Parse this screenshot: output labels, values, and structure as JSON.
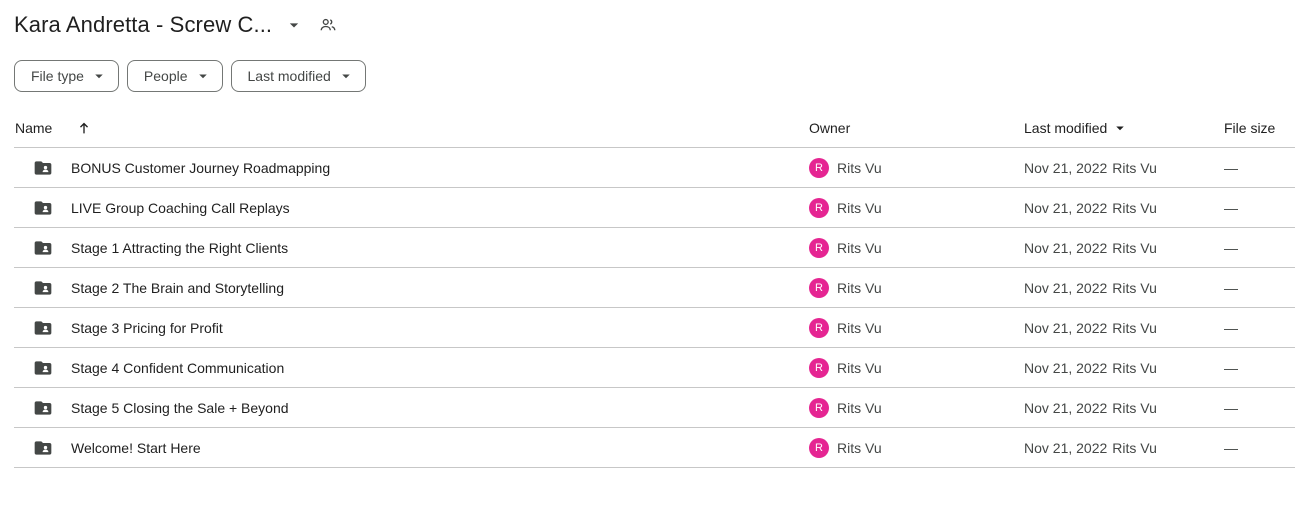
{
  "header": {
    "title": "Kara Andretta - Screw C...",
    "caret_icon": "arrow-drop-down-icon",
    "share_icon": "people-icon"
  },
  "filters": [
    {
      "label": "File type"
    },
    {
      "label": "People"
    },
    {
      "label": "Last modified"
    }
  ],
  "columns": {
    "name": "Name",
    "owner": "Owner",
    "last_modified": "Last modified",
    "file_size": "File size"
  },
  "colors": {
    "avatar": "#e52592",
    "folder": "#444746",
    "divider": "#c7c7c7"
  },
  "rows": [
    {
      "name": "BONUS Customer Journey Roadmapping",
      "owner_initial": "R",
      "owner": "Rits Vu",
      "modified_date": "Nov 21, 2022",
      "modified_by": "Rits Vu",
      "size": "—"
    },
    {
      "name": "LIVE Group Coaching Call Replays",
      "owner_initial": "R",
      "owner": "Rits Vu",
      "modified_date": "Nov 21, 2022",
      "modified_by": "Rits Vu",
      "size": "—"
    },
    {
      "name": "Stage 1 Attracting the Right Clients",
      "owner_initial": "R",
      "owner": "Rits Vu",
      "modified_date": "Nov 21, 2022",
      "modified_by": "Rits Vu",
      "size": "—"
    },
    {
      "name": "Stage 2 The Brain and Storytelling",
      "owner_initial": "R",
      "owner": "Rits Vu",
      "modified_date": "Nov 21, 2022",
      "modified_by": "Rits Vu",
      "size": "—"
    },
    {
      "name": "Stage 3 Pricing for Profit",
      "owner_initial": "R",
      "owner": "Rits Vu",
      "modified_date": "Nov 21, 2022",
      "modified_by": "Rits Vu",
      "size": "—"
    },
    {
      "name": "Stage 4 Confident Communication",
      "owner_initial": "R",
      "owner": "Rits Vu",
      "modified_date": "Nov 21, 2022",
      "modified_by": "Rits Vu",
      "size": "—"
    },
    {
      "name": "Stage 5 Closing the Sale + Beyond",
      "owner_initial": "R",
      "owner": "Rits Vu",
      "modified_date": "Nov 21, 2022",
      "modified_by": "Rits Vu",
      "size": "—"
    },
    {
      "name": "Welcome! Start Here",
      "owner_initial": "R",
      "owner": "Rits Vu",
      "modified_date": "Nov 21, 2022",
      "modified_by": "Rits Vu",
      "size": "—"
    }
  ]
}
